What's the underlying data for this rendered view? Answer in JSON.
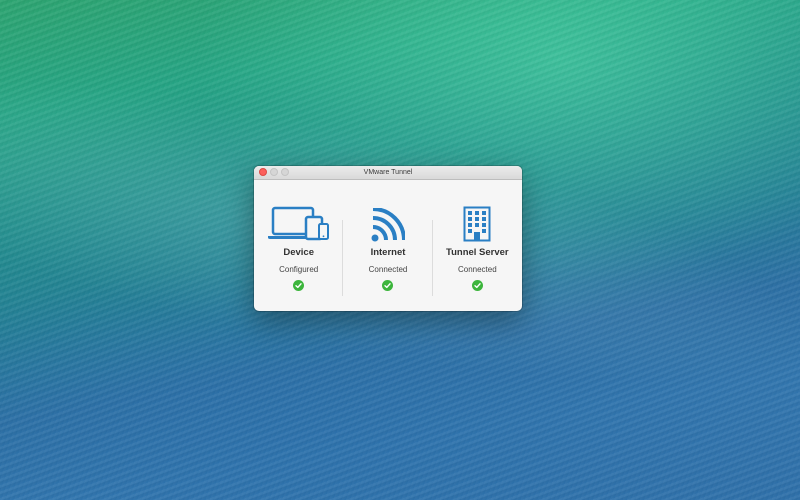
{
  "window": {
    "title": "VMware Tunnel"
  },
  "statuses": [
    {
      "label": "Device",
      "status": "Configured",
      "icon": "devices-icon"
    },
    {
      "label": "Internet",
      "status": "Connected",
      "icon": "wifi-signal-icon"
    },
    {
      "label": "Tunnel Server",
      "status": "Connected",
      "icon": "building-icon"
    }
  ],
  "colors": {
    "icon_blue": "#2a7fc4",
    "check_green": "#3cb53c",
    "close_red": "#fc605c"
  }
}
